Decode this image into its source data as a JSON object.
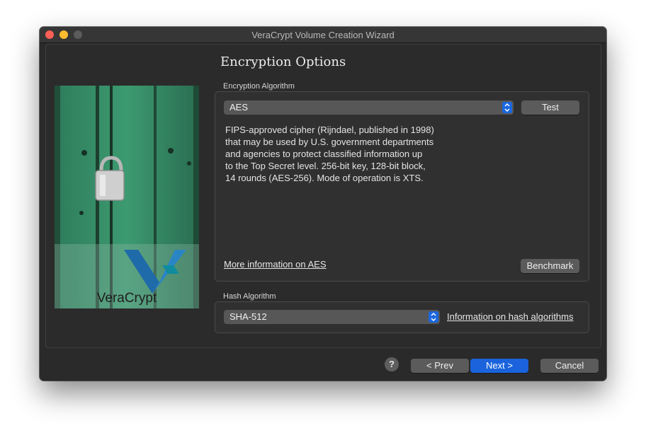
{
  "window": {
    "title": "VeraCrypt Volume Creation Wizard"
  },
  "page": {
    "title": "Encryption Options"
  },
  "branding": {
    "logo_text": "VeraCrypt"
  },
  "encryption": {
    "group_label": "Encryption Algorithm",
    "selected": "AES",
    "test_label": "Test",
    "description": "FIPS-approved cipher (Rijndael, published in 1998)\nthat may be used by U.S. government departments\nand agencies to protect classified information up\nto the Top Secret level. 256-bit key, 128-bit block,\n14 rounds (AES-256). Mode of operation is XTS.",
    "more_info_link": "More information on AES",
    "benchmark_label": "Benchmark"
  },
  "hash": {
    "group_label": "Hash Algorithm",
    "selected": "SHA-512",
    "info_link": "Information on hash algorithms"
  },
  "footer": {
    "help_label": "?",
    "prev_label": "< Prev",
    "next_label": "Next >",
    "cancel_label": "Cancel"
  },
  "colors": {
    "accent": "#1a63dc",
    "window_bg": "#2a2a2a",
    "close": "#fe5f57",
    "minimize": "#febc2e"
  }
}
